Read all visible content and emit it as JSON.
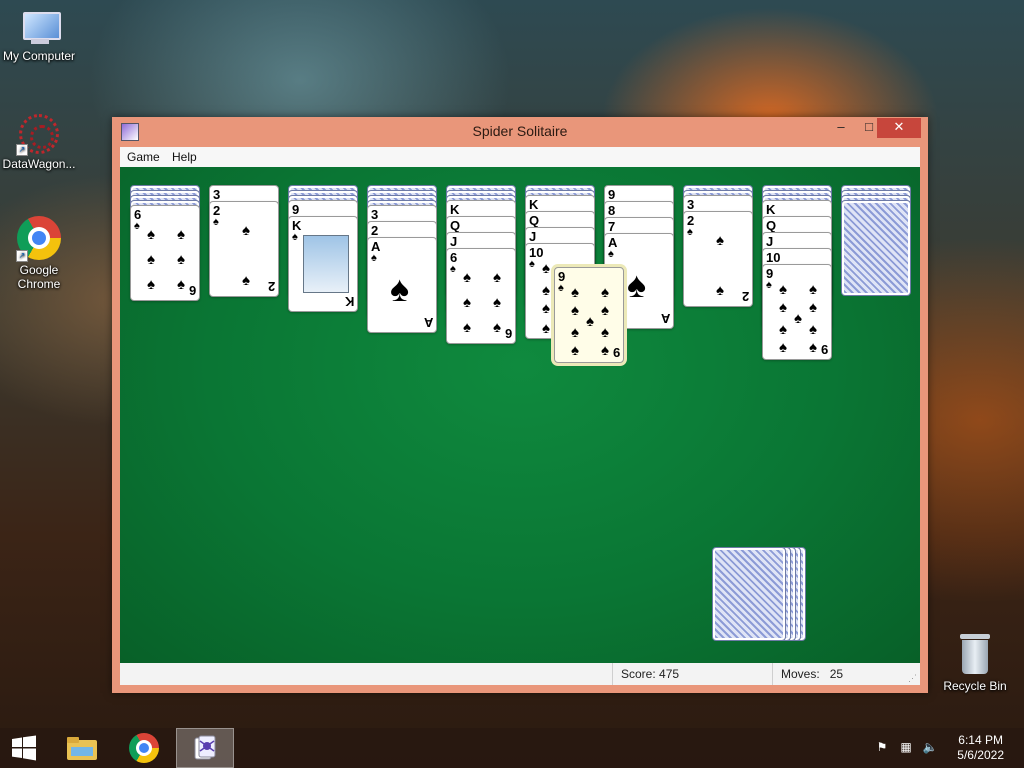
{
  "desktop": {
    "icons": [
      {
        "label": "My Computer"
      },
      {
        "label": "DataWagon..."
      },
      {
        "label": "Google Chrome"
      },
      {
        "label": "Recycle Bin"
      }
    ]
  },
  "window": {
    "title": "Spider Solitaire",
    "controls": {
      "minimize": "–",
      "maximize": "□",
      "close": "✕"
    },
    "menu": [
      "Game",
      "Help"
    ],
    "status": {
      "score_label": "Score: 475",
      "moves_label": "Moves:",
      "moves_value": "25"
    }
  },
  "game": {
    "suit_symbol": "♠",
    "tableau": [
      {
        "down": 4,
        "up": [
          "6"
        ]
      },
      {
        "down": 0,
        "up": [
          "3",
          "2"
        ]
      },
      {
        "down": 3,
        "up": [
          "9",
          "K"
        ]
      },
      {
        "down": 4,
        "up": [
          "3",
          "2",
          "A"
        ]
      },
      {
        "down": 3,
        "up": [
          "K",
          "Q",
          "J",
          "6"
        ]
      },
      {
        "down": 2,
        "up": [
          "K",
          "Q",
          "J",
          "10"
        ]
      },
      {
        "down": 0,
        "up": [
          "9",
          "8",
          "7",
          "A"
        ]
      },
      {
        "down": 2,
        "up": [
          "3",
          "2"
        ]
      },
      {
        "down": 3,
        "up": [
          "K",
          "Q",
          "J",
          "10",
          "9"
        ]
      },
      {
        "down": 4,
        "up": []
      }
    ],
    "dragging_card": "9",
    "stock_deals_remaining": 5
  },
  "taskbar": {
    "clock_time": "6:14 PM",
    "clock_date": "5/6/2022",
    "icons": [
      "windows-start-icon",
      "file-explorer-icon",
      "chrome-icon",
      "spider-solitaire-icon"
    ]
  }
}
